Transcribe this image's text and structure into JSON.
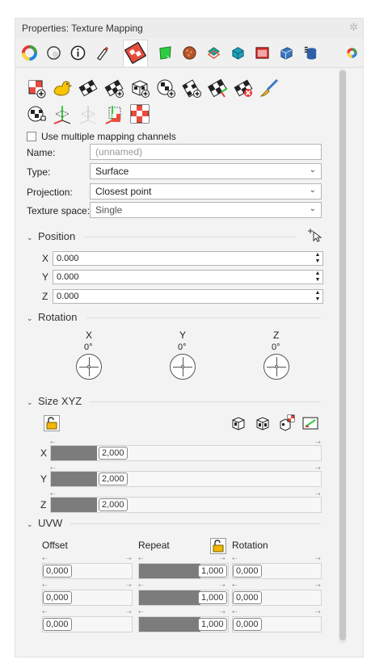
{
  "panel": {
    "title": "Properties: Texture Mapping",
    "settings_icon": "gear-icon"
  },
  "tabs": [
    {
      "name": "material-color-icon",
      "color": "#e53935"
    },
    {
      "name": "environment-sphere-icon",
      "color": "#dddddd"
    },
    {
      "name": "info-icon",
      "color": "#222222"
    },
    {
      "name": "paint-tube-icon",
      "color": "#c0392b"
    },
    {
      "name": "texture-mapping-icon",
      "color": "#e84c3d",
      "selected": true
    },
    {
      "name": "green-decal-icon",
      "color": "#2ecc40"
    },
    {
      "name": "bump-texture-icon",
      "color": "#a0522d"
    },
    {
      "name": "teal-puzzle-icon",
      "color": "#18a999"
    },
    {
      "name": "cyan-object-icon",
      "color": "#1e9fb6"
    },
    {
      "name": "red-window-icon",
      "color": "#d32f2f"
    },
    {
      "name": "blue-box-icon",
      "color": "#3b78c3"
    },
    {
      "name": "cylinder-stack-icon",
      "color": "#2e5fa8"
    },
    {
      "name": "color-wheel-icon",
      "color": "#8e44ad"
    }
  ],
  "mapping_icons_row1": [
    "add-custom-mapping-icon",
    "duck-mapping-icon",
    "planar-mapping-icon",
    "planar-add-icon",
    "box-mapping-icon",
    "spherical-mapping-icon",
    "cylindrical-mapping-icon",
    "surface-mapping-icon",
    "remove-mapping-icon",
    "brush-icon"
  ],
  "mapping_icons_row2": [
    "sphere-mapping-icon",
    "widget-show-icon",
    "widget-hide-icon",
    "widget-edit-icon",
    "red-checker-icon"
  ],
  "use_multiple_channels": {
    "label": "Use multiple mapping channels",
    "checked": false
  },
  "name": {
    "label": "Name:",
    "placeholder": "(unnamed)",
    "value": ""
  },
  "type": {
    "label": "Type:",
    "value": "Surface"
  },
  "projection": {
    "label": "Projection:",
    "value": "Closest point"
  },
  "texture_space": {
    "label": "Texture space:",
    "value": "Single"
  },
  "position": {
    "title": "Position",
    "pick_icon": "pick-point-icon",
    "x": {
      "label": "X",
      "value": "0.000"
    },
    "y": {
      "label": "Y",
      "value": "0.000"
    },
    "z": {
      "label": "Z",
      "value": "0.000"
    }
  },
  "rotation": {
    "title": "Rotation",
    "x": {
      "label": "X",
      "value": "0°"
    },
    "y": {
      "label": "Y",
      "value": "0°"
    },
    "z": {
      "label": "Z",
      "value": "0°"
    }
  },
  "size": {
    "title": "Size XYZ",
    "lock_icon": "lock-open-icon",
    "tools": [
      "box-view-1-icon",
      "box-view-2-icon",
      "uniform-scale-icon",
      "fit-edit-icon"
    ],
    "x": {
      "label": "X",
      "value": "2,000",
      "fill": 0.17
    },
    "y": {
      "label": "Y",
      "value": "2,000",
      "fill": 0.17
    },
    "z": {
      "label": "Z",
      "value": "2,000",
      "fill": 0.17
    }
  },
  "uvw": {
    "title": "UVW",
    "offset_label": "Offset",
    "repeat_label": "Repeat",
    "rotation_label": "Rotation",
    "lock_icon": "lock-open-icon",
    "rows": [
      {
        "offset": "0,000",
        "repeat": "1,000",
        "rotation": "0,000"
      },
      {
        "offset": "0,000",
        "repeat": "1,000",
        "rotation": "0,000"
      },
      {
        "offset": "0,000",
        "repeat": "1,000",
        "rotation": "0,000"
      }
    ]
  }
}
